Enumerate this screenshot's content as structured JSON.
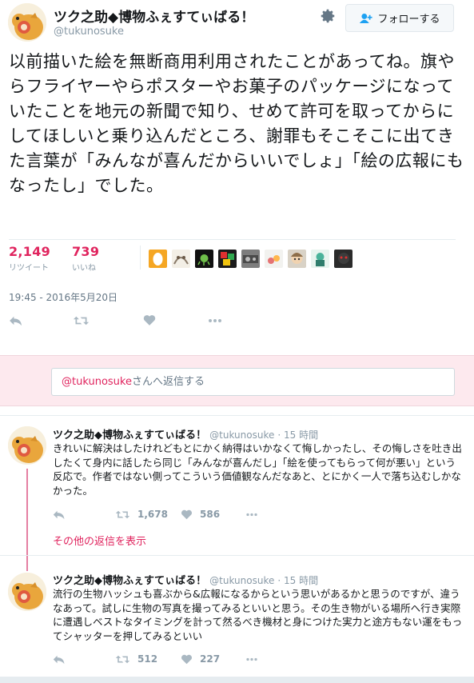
{
  "main_tweet": {
    "name": "ツク之助◆博物ふぇすてぃばる！",
    "handle": "@tukunosuke",
    "follow_label": "フォローする",
    "text": "以前描いた絵を無断商用利用されたことがあってね。旗やらフライヤーやらポスターやお菓子のパッケージになっていたことを地元の新聞で知り、せめて許可を取ってからにしてほしいと乗り込んだところ、謝罪もそこそこに出てきた言葉が「みんなが喜んだからいいでしょ」「絵の広報にもなったし」でした。",
    "retweets": "2,149",
    "retweets_label": "リツイート",
    "likes": "739",
    "likes_label": "いいね",
    "timestamp": "19:45 - 2016年5月20日"
  },
  "reply_box": {
    "mention": "@tukunosuke",
    "placeholder_suffix": "さんへ返信する"
  },
  "replies": [
    {
      "name": "ツク之助◆博物ふぇすてぃばる！",
      "handle": "@tukunosuke",
      "time": "· 15 時間",
      "text": "きれいに解決はしたけれどもとにかく納得はいかなくて悔しかったし、その悔しさを吐き出したくて身内に話したら同じ「みんなが喜んだし」「絵を使ってもらって何が悪い」という反応で。作者ではない側ってこういう価値観なんだなあと、とにかく一人で落ち込むしかなかった。",
      "retweets": "1,678",
      "likes": "586"
    },
    {
      "name": "ツク之助◆博物ふぇすてぃばる！",
      "handle": "@tukunosuke",
      "time": "· 15 時間",
      "text": "流行の生物ハッシュも喜ぶから&広報になるからという思いがあるかと思うのですが、違うなあって。試しに生物の写真を撮ってみるといいと思う。その生き物がいる場所へ行き実際に遭遇しベストなタイミングを計って然るべき機材と身につけた実力と途方もない運をもってシャッターを押してみるといい",
      "retweets": "512",
      "likes": "227"
    }
  ],
  "more_replies_label": "その他の返信を表示",
  "colors": {
    "accent": "#e0245e",
    "muted": "#8899a6",
    "reply_bg": "#fde9ee",
    "thread_line": "#e47fa2"
  },
  "icons": [
    "gear-icon",
    "follow-user-icon",
    "reply-icon",
    "retweet-icon",
    "heart-icon",
    "more-icon"
  ]
}
